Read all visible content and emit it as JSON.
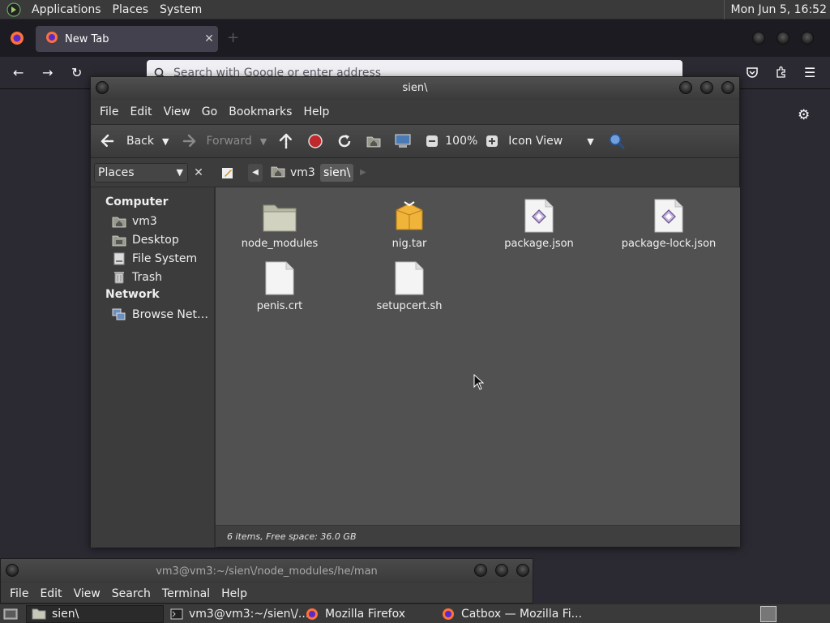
{
  "top_panel": {
    "menus": [
      "Applications",
      "Places",
      "System"
    ],
    "clock": "Mon Jun  5, 16:52"
  },
  "firefox": {
    "tab_title": "New Tab",
    "tab_close": "✕",
    "new_tab": "+",
    "url_placeholder": "Search with Google or enter address"
  },
  "file_manager": {
    "title": "sien\\",
    "menus": [
      "File",
      "Edit",
      "View",
      "Go",
      "Bookmarks",
      "Help"
    ],
    "toolbar": {
      "back": "Back",
      "forward": "Forward",
      "zoom": "100%",
      "view_mode": "Icon View"
    },
    "location": {
      "places_label": "Places",
      "close": "✕",
      "crumbs": [
        "vm3",
        "sien\\"
      ]
    },
    "sidebar": {
      "computer_heading": "Computer",
      "computer_items": [
        "vm3",
        "Desktop",
        "File System",
        "Trash"
      ],
      "network_heading": "Network",
      "network_items": [
        "Browse Net…"
      ]
    },
    "files": [
      {
        "name": "node_modules",
        "type": "folder"
      },
      {
        "name": "nig.tar",
        "type": "archive"
      },
      {
        "name": "package.json",
        "type": "json"
      },
      {
        "name": "package-lock.json",
        "type": "json"
      },
      {
        "name": "penis.crt",
        "type": "text"
      },
      {
        "name": "setupcert.sh",
        "type": "text"
      }
    ],
    "status": "6 items, Free space: 36.0 GB"
  },
  "terminal": {
    "title": "vm3@vm3:~/sien\\/node_modules/he/man",
    "menus": [
      "File",
      "Edit",
      "View",
      "Search",
      "Terminal",
      "Help"
    ]
  },
  "taskbar": {
    "tasks": [
      "sien\\",
      "vm3@vm3:~/sien\\/...",
      "Mozilla Firefox",
      "Catbox — Mozilla Fi..."
    ]
  }
}
